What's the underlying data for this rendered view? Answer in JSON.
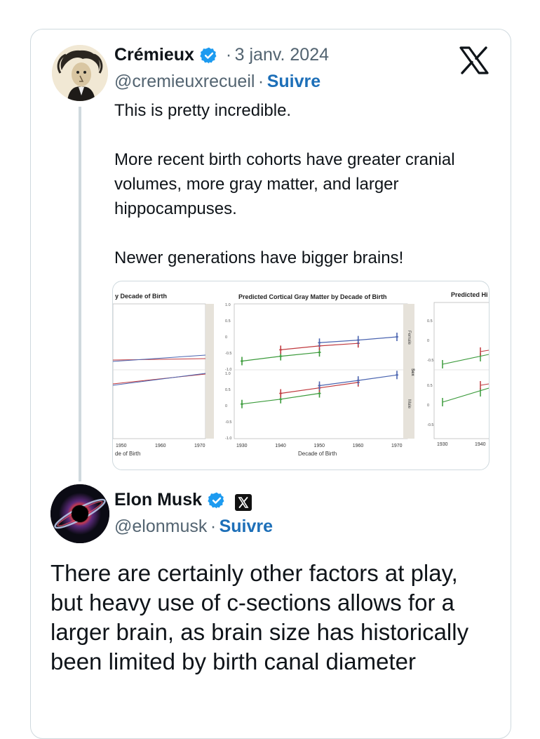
{
  "quoted_tweet": {
    "author_name": "Crémieux",
    "date": "3 janv. 2024",
    "handle": "@cremieuxrecueil",
    "follow_label": "Suivre",
    "text": [
      "This is pretty incredible.",
      "More recent birth cohorts have greater cranial volumes, more gray matter, and larger hippocampuses.",
      "Newer generations have bigger brains!"
    ]
  },
  "reply_tweet": {
    "author_name": "Elon Musk",
    "handle": "@elonmusk",
    "follow_label": "Suivre",
    "text": "There are certainly other factors at play, but heavy use of c-sections allows for a larger brain, as brain size has historically been limited by birth canal diameter"
  },
  "separator": "·",
  "icons": {
    "verified": "verified-badge-icon",
    "x_logo": "x-logo-icon",
    "affiliate": "x-affiliate-badge-icon"
  },
  "colors": {
    "link": "#1d6fb8",
    "verified": "#1d9bf0",
    "muted": "#536471",
    "border": "#cfd9de"
  },
  "chart_image": {
    "left_panel": {
      "title": "y Decade of Birth",
      "x_ticks": [
        "1950",
        "1960",
        "1970"
      ],
      "x_label": "de of Birth"
    },
    "middle_panel": {
      "title": "Predicted Cortical Gray Matter by Decade of Birth",
      "y_ticks_top": [
        "1.0",
        "0.5",
        "0",
        "-0.5",
        "-1.0"
      ],
      "y_ticks_bottom": [
        "1.0",
        "0.5",
        "0",
        "-0.5",
        "-1.0"
      ],
      "x_ticks": [
        "1930",
        "1940",
        "1950",
        "1960",
        "1970"
      ],
      "x_label": "Decade of Birth",
      "strip_top": "Female",
      "strip_bottom": "Male",
      "sex_label": "Sex"
    },
    "right_panel": {
      "title": "Predicted Hi",
      "y_ticks_top": [
        "0.5",
        "0",
        "-0.5"
      ],
      "y_ticks_bottom": [
        "0.5",
        "0",
        "-0.5"
      ],
      "x_ticks": [
        "1930",
        "1940"
      ]
    },
    "middle_series": {
      "female": {
        "green": [
          [
            1930,
            -0.75
          ],
          [
            1940,
            -0.6
          ],
          [
            1950,
            -0.48
          ]
        ],
        "red": [
          [
            1940,
            -0.4
          ],
          [
            1950,
            -0.28
          ],
          [
            1960,
            -0.2
          ]
        ],
        "blue": [
          [
            1950,
            -0.18
          ],
          [
            1960,
            -0.1
          ],
          [
            1970,
            0.0
          ]
        ]
      },
      "male": {
        "green": [
          [
            1930,
            0.05
          ],
          [
            1940,
            0.2
          ],
          [
            1950,
            0.38
          ]
        ],
        "red": [
          [
            1940,
            0.38
          ],
          [
            1950,
            0.55
          ],
          [
            1960,
            0.72
          ]
        ],
        "blue": [
          [
            1950,
            0.62
          ],
          [
            1960,
            0.78
          ],
          [
            1970,
            0.95
          ]
        ]
      }
    }
  }
}
